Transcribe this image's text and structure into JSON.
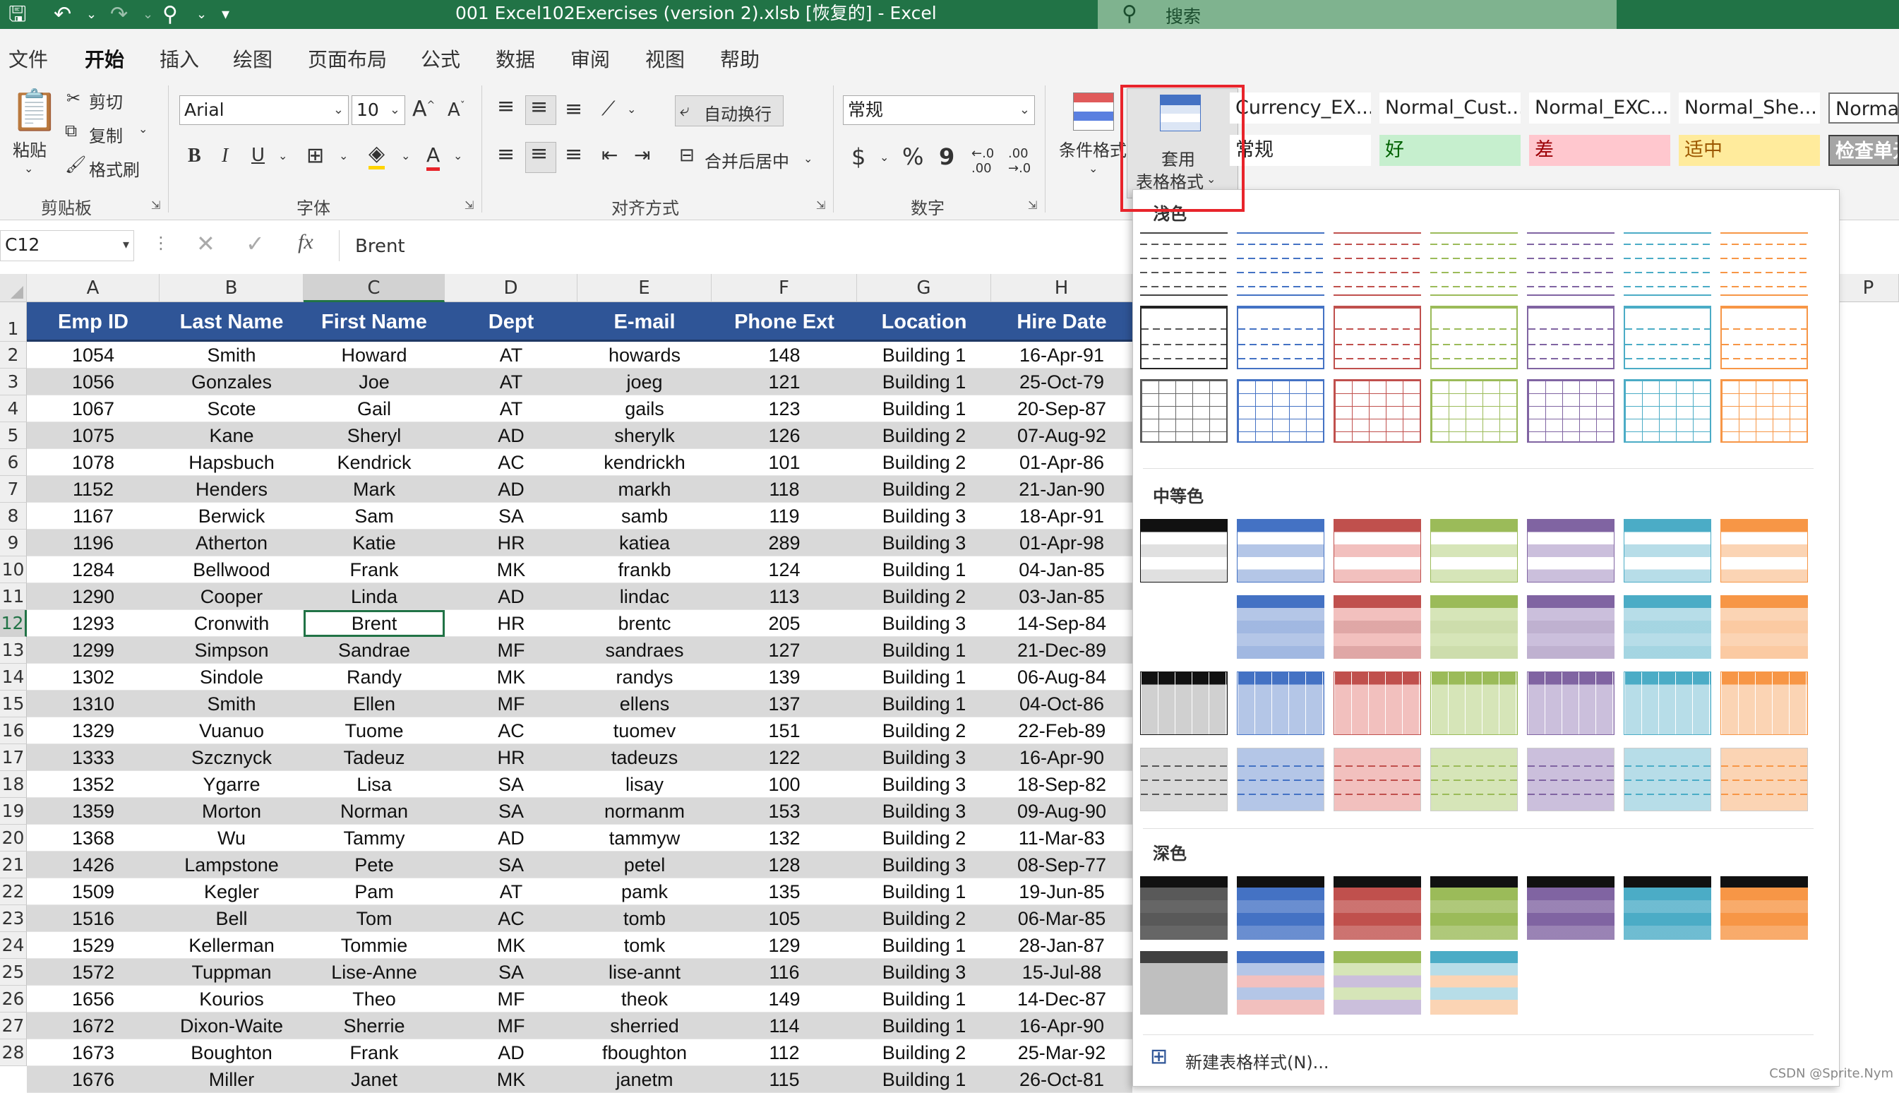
{
  "titlebar": {
    "title": "001 Excel102Exercises (version 2).xlsb [恢复的]  -  Excel",
    "search_placeholder": "搜索"
  },
  "tabs": [
    "文件",
    "开始",
    "插入",
    "绘图",
    "页面布局",
    "公式",
    "数据",
    "审阅",
    "视图",
    "帮助"
  ],
  "ribbon": {
    "clipboard": {
      "paste": "粘贴",
      "cut": "剪切",
      "copy": "复制",
      "format_painter": "格式刷",
      "group": "剪贴板"
    },
    "font": {
      "name": "Arial",
      "size": "10",
      "group": "字体",
      "bold": "B",
      "italic": "I",
      "underline": "U",
      "font_color": "A"
    },
    "alignment": {
      "wrap": "自动换行",
      "merge": "合并后居中",
      "group": "对齐方式"
    },
    "number": {
      "format": "常规",
      "currency": "$",
      "percent": "%",
      "comma": "9",
      "group": "数字"
    },
    "styles": {
      "conditional": "条件格式",
      "table_format_line1": "套用",
      "table_format_line2": "表格格式",
      "cell_styles_row1": [
        "Currency_EX...",
        "Normal_Cust...",
        "Normal_EXC...",
        "Normal_She...",
        "Normal_"
      ],
      "cell_styles_row2": [
        "常规",
        "好",
        "差",
        "适中",
        "检查单元"
      ]
    }
  },
  "formula_bar": {
    "name_box": "C12",
    "fx": "fx",
    "content": "Brent"
  },
  "grid": {
    "columns": [
      "A",
      "B",
      "C",
      "D",
      "E",
      "F",
      "G",
      "H"
    ],
    "extra_column": "P",
    "header_row": [
      "Emp ID",
      "Last Name",
      "First Name",
      "Dept",
      "E-mail",
      "Phone Ext",
      "Location",
      "Hire Date"
    ],
    "row_numbers": [
      "1",
      "2",
      "3",
      "4",
      "5",
      "6",
      "7",
      "8",
      "9",
      "10",
      "11",
      "12",
      "13",
      "14",
      "15",
      "16",
      "17",
      "18",
      "19",
      "20",
      "21",
      "22",
      "23",
      "24",
      "25",
      "26",
      "27",
      "28"
    ],
    "rows": [
      [
        "1054",
        "Smith",
        "Howard",
        "AT",
        "howards",
        "148",
        "Building 1",
        "16-Apr-91"
      ],
      [
        "1056",
        "Gonzales",
        "Joe",
        "AT",
        "joeg",
        "121",
        "Building 1",
        "25-Oct-79"
      ],
      [
        "1067",
        "Scote",
        "Gail",
        "AT",
        "gails",
        "123",
        "Building 1",
        "20-Sep-87"
      ],
      [
        "1075",
        "Kane",
        "Sheryl",
        "AD",
        "sherylk",
        "126",
        "Building 2",
        "07-Aug-92"
      ],
      [
        "1078",
        "Hapsbuch",
        "Kendrick",
        "AC",
        "kendrickh",
        "101",
        "Building 2",
        "01-Apr-86"
      ],
      [
        "1152",
        "Henders",
        "Mark",
        "AD",
        "markh",
        "118",
        "Building 2",
        "21-Jan-90"
      ],
      [
        "1167",
        "Berwick",
        "Sam",
        "SA",
        "samb",
        "119",
        "Building 3",
        "18-Apr-91"
      ],
      [
        "1196",
        "Atherton",
        "Katie",
        "HR",
        "katiea",
        "289",
        "Building 3",
        "01-Apr-98"
      ],
      [
        "1284",
        "Bellwood",
        "Frank",
        "MK",
        "frankb",
        "124",
        "Building 1",
        "04-Jan-85"
      ],
      [
        "1290",
        "Cooper",
        "Linda",
        "AD",
        "lindac",
        "113",
        "Building 2",
        "03-Jan-85"
      ],
      [
        "1293",
        "Cronwith",
        "Brent",
        "HR",
        "brentc",
        "205",
        "Building 3",
        "14-Sep-84"
      ],
      [
        "1299",
        "Simpson",
        "Sandrae",
        "MF",
        "sandraes",
        "127",
        "Building 1",
        "21-Dec-89"
      ],
      [
        "1302",
        "Sindole",
        "Randy",
        "MK",
        "randys",
        "139",
        "Building 1",
        "06-Aug-84"
      ],
      [
        "1310",
        "Smith",
        "Ellen",
        "MF",
        "ellens",
        "137",
        "Building 1",
        "04-Oct-86"
      ],
      [
        "1329",
        "Vuanuo",
        "Tuome",
        "AC",
        "tuomev",
        "151",
        "Building 2",
        "22-Feb-89"
      ],
      [
        "1333",
        "Szcznyck",
        "Tadeuz",
        "HR",
        "tadeuzs",
        "122",
        "Building 3",
        "16-Apr-90"
      ],
      [
        "1352",
        "Ygarre",
        "Lisa",
        "SA",
        "lisay",
        "100",
        "Building 3",
        "18-Sep-82"
      ],
      [
        "1359",
        "Morton",
        "Norman",
        "SA",
        "normanm",
        "153",
        "Building 3",
        "09-Aug-90"
      ],
      [
        "1368",
        "Wu",
        "Tammy",
        "AD",
        "tammyw",
        "132",
        "Building 2",
        "11-Mar-83"
      ],
      [
        "1426",
        "Lampstone",
        "Pete",
        "SA",
        "petel",
        "128",
        "Building 3",
        "08-Sep-77"
      ],
      [
        "1509",
        "Kegler",
        "Pam",
        "AT",
        "pamk",
        "135",
        "Building 1",
        "19-Jun-85"
      ],
      [
        "1516",
        "Bell",
        "Tom",
        "AC",
        "tomb",
        "105",
        "Building 2",
        "06-Mar-85"
      ],
      [
        "1529",
        "Kellerman",
        "Tommie",
        "MK",
        "tomk",
        "129",
        "Building 1",
        "28-Jan-87"
      ],
      [
        "1572",
        "Tuppman",
        "Lise-Anne",
        "SA",
        "lise-annt",
        "116",
        "Building 3",
        "15-Jul-88"
      ],
      [
        "1656",
        "Kourios",
        "Theo",
        "MF",
        "theok",
        "149",
        "Building 1",
        "14-Dec-87"
      ],
      [
        "1672",
        "Dixon-Waite",
        "Sherrie",
        "MF",
        "sherried",
        "114",
        "Building 1",
        "16-Apr-90"
      ],
      [
        "1673",
        "Boughton",
        "Frank",
        "AD",
        "fboughton",
        "112",
        "Building 2",
        "25-Mar-92"
      ],
      [
        "1676",
        "Miller",
        "Janet",
        "MK",
        "janetm",
        "115",
        "Building 1",
        "26-Oct-81"
      ]
    ]
  },
  "gallery": {
    "section_light": "浅色",
    "section_medium": "中等色",
    "section_dark": "深色",
    "new_style": "新建表格样式(N)..."
  },
  "colors": {
    "accent": "#217346",
    "header_fill": "#2f5597",
    "band_fill": "#d9d9d9",
    "swatches": [
      "#404040",
      "#4472c4",
      "#c0504d",
      "#9bbb59",
      "#8064a2",
      "#4bacc6",
      "#f79646"
    ],
    "swatches_light": [
      "#bfbfbf",
      "#b4c6e7",
      "#f2c0be",
      "#d6e5b8",
      "#cbbfdc",
      "#b7dde8",
      "#fbd4b4"
    ]
  },
  "watermark": "CSDN @Sprite.Nym"
}
